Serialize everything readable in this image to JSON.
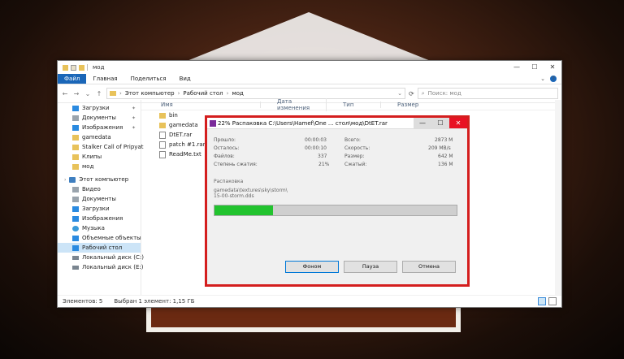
{
  "explorer": {
    "title": "мод",
    "window_controls": [
      "—",
      "☐",
      "✕"
    ],
    "ribbon_tabs": [
      "Файл",
      "Главная",
      "Поделиться",
      "Вид"
    ],
    "address": {
      "crumbs": [
        "Этот компьютер",
        "Рабочий стол",
        "мод"
      ],
      "chevrons": [
        "›",
        "›",
        "›"
      ]
    },
    "search_placeholder": "Поиск: мод",
    "nav": {
      "quick": [
        {
          "label": "Загрузки",
          "icon": "download-icon"
        },
        {
          "label": "Документы",
          "icon": "documents-icon"
        },
        {
          "label": "Изображения",
          "icon": "images-icon"
        },
        {
          "label": "gamedata",
          "icon": "folder-icon"
        },
        {
          "label": "Stalker Call of Pripyat",
          "icon": "folder-icon"
        },
        {
          "label": "Клипы",
          "icon": "folder-icon"
        },
        {
          "label": "мод",
          "icon": "folder-icon"
        }
      ],
      "this_pc": "Этот компьютер",
      "pc_items": [
        {
          "label": "Видео"
        },
        {
          "label": "Документы"
        },
        {
          "label": "Загрузки"
        },
        {
          "label": "Изображения"
        },
        {
          "label": "Музыка"
        },
        {
          "label": "Объемные объекты"
        },
        {
          "label": "Рабочий стол"
        },
        {
          "label": "Локальный диск (C:)"
        },
        {
          "label": "Локальный диск (E:)"
        }
      ]
    },
    "columns": [
      "Имя",
      "Дата изменения",
      "Тип",
      "Размер"
    ],
    "files": [
      {
        "name": "bin",
        "icon": "folder-icon"
      },
      {
        "name": "gamedata",
        "icon": "folder-icon"
      },
      {
        "name": "DtET.rar",
        "icon": "archive-icon"
      },
      {
        "name": "patch #1.rar",
        "icon": "archive-icon"
      },
      {
        "name": "ReadMe.txt",
        "icon": "text-file-icon"
      }
    ],
    "status": {
      "items": "Элементов: 5",
      "selected": "Выбран 1 элемент: 1,15 ГБ"
    }
  },
  "winrar": {
    "title": "22% Распаковка C:\\Users\\Hamef\\One ... стол\\мод\\DtET.rar",
    "stats_left": [
      {
        "label": "Прошло:",
        "value": "00:00:03"
      },
      {
        "label": "Осталось:",
        "value": "00:00:10"
      },
      {
        "label": "Файлов:",
        "value": "337"
      },
      {
        "label": "Степень сжатия:",
        "value": "21%"
      }
    ],
    "stats_right": [
      {
        "label": "Всего:",
        "value": "2873 M"
      },
      {
        "label": "Скорость:",
        "value": "209 MB/s"
      },
      {
        "label": "Размер:",
        "value": "642 M"
      },
      {
        "label": "Сжатый:",
        "value": "136 M"
      }
    ],
    "section_label": "Распаковка",
    "current_file_line1": "gamedata\\textures\\sky\\storm\\",
    "current_file_line2": "15-00-storm.dds",
    "progress_fraction": 0.24,
    "buttons": {
      "background": "Фоном",
      "pause": "Пауза",
      "cancel": "Отмена"
    }
  }
}
